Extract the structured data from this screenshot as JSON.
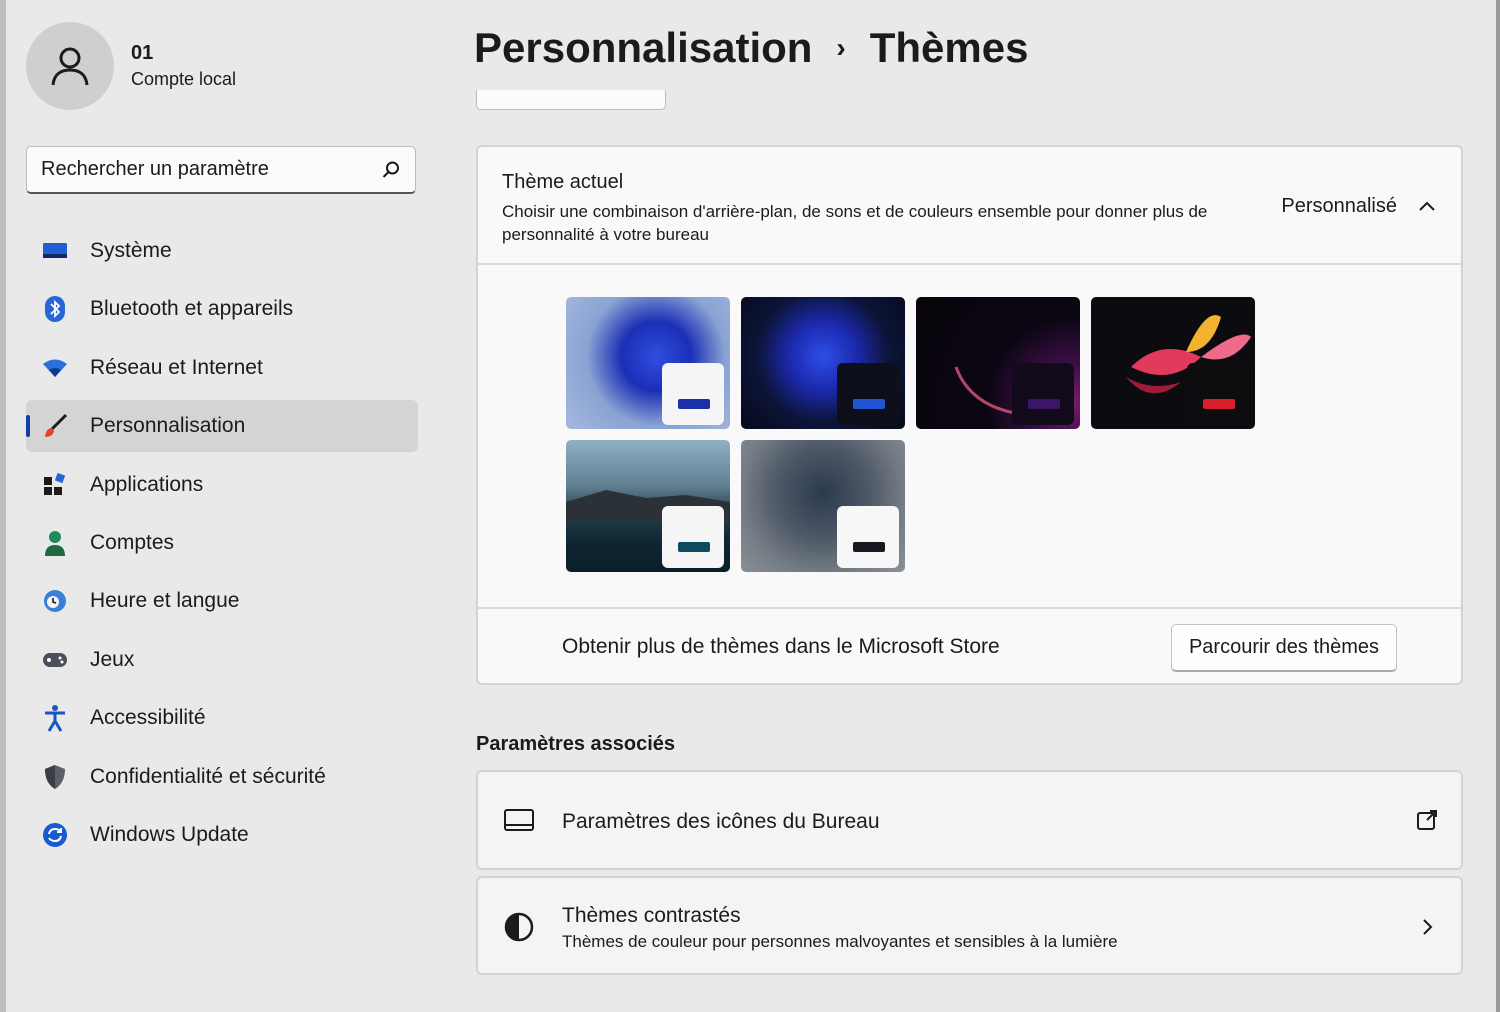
{
  "user": {
    "name": "01",
    "account_type": "Compte local"
  },
  "search": {
    "placeholder": "Rechercher un paramètre"
  },
  "sidebar": {
    "items": [
      {
        "label": "Système",
        "icon": "display-icon",
        "active": false
      },
      {
        "label": "Bluetooth et appareils",
        "icon": "bluetooth-icon",
        "active": false
      },
      {
        "label": "Réseau et Internet",
        "icon": "wifi-icon",
        "active": false
      },
      {
        "label": "Personnalisation",
        "icon": "brush-icon",
        "active": true
      },
      {
        "label": "Applications",
        "icon": "apps-icon",
        "active": false
      },
      {
        "label": "Comptes",
        "icon": "person-icon",
        "active": false
      },
      {
        "label": "Heure et langue",
        "icon": "clock-globe-icon",
        "active": false
      },
      {
        "label": "Jeux",
        "icon": "gamepad-icon",
        "active": false
      },
      {
        "label": "Accessibilité",
        "icon": "accessibility-icon",
        "active": false
      },
      {
        "label": "Confidentialité et sécurité",
        "icon": "shield-icon",
        "active": false
      },
      {
        "label": "Windows Update",
        "icon": "update-icon",
        "active": false
      }
    ]
  },
  "breadcrumb": {
    "parent": "Personnalisation",
    "current": "Thèmes"
  },
  "current_theme": {
    "title": "Thème actuel",
    "description": "Choisir une combinaison d'arrière-plan, de sons et de couleurs ensemble pour donner plus de personnalité à votre bureau",
    "value": "Personnalisé",
    "expanded": true
  },
  "themes": [
    {
      "name": "windows-light-theme",
      "bg": "#7d93c4",
      "window": "#f5f5f7",
      "accent": "#1a2fa8"
    },
    {
      "name": "windows-dark-theme",
      "bg": "#0b0f24",
      "window": "#0d0f1a",
      "accent": "#2454d6"
    },
    {
      "name": "glow-theme",
      "bg": "#0a0612",
      "window": "#120b1c",
      "accent": "#3b1566"
    },
    {
      "name": "captured-motion-theme",
      "bg": "#0b0b10",
      "window": "#0d0d10",
      "accent": "#d81e2b"
    },
    {
      "name": "sunrise-theme",
      "bg": "#3f5e6e",
      "window": "#f5f5f5",
      "accent": "#0f4a5e"
    },
    {
      "name": "flow-theme",
      "bg": "#5c6670",
      "window": "#f7f7f7",
      "accent": "#161a20"
    }
  ],
  "store": {
    "text": "Obtenir plus de thèmes dans le Microsoft Store",
    "button": "Parcourir des thèmes"
  },
  "related": {
    "title": "Paramètres associés",
    "items": [
      {
        "title": "Paramètres des icônes du Bureau",
        "subtitle": "",
        "icon": "desktop-icon",
        "action_icon": "open-external-icon"
      },
      {
        "title": "Thèmes contrastés",
        "subtitle": "Thèmes de couleur pour personnes malvoyantes et sensibles à la lumière",
        "icon": "contrast-icon",
        "action_icon": "chevron-right-icon"
      }
    ]
  }
}
